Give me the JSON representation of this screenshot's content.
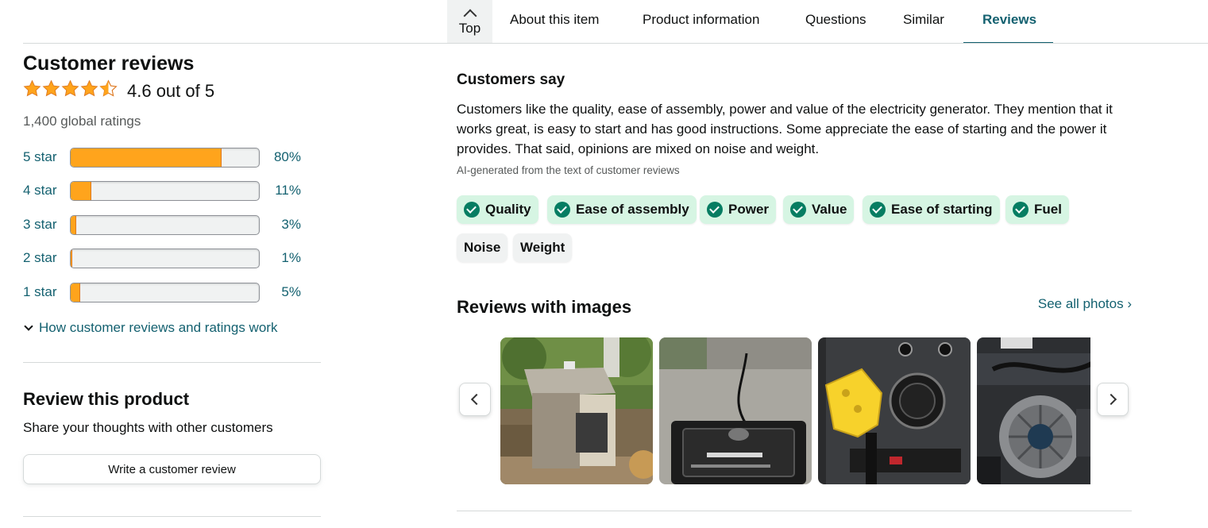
{
  "nav": {
    "top_label": "Top",
    "tabs": [
      {
        "label": "About this item",
        "active": false
      },
      {
        "label": "Product information",
        "active": false
      },
      {
        "label": "Questions",
        "active": false
      },
      {
        "label": "Similar",
        "active": false
      },
      {
        "label": "Reviews",
        "active": true
      }
    ]
  },
  "reviews_summary": {
    "title": "Customer reviews",
    "rating_value": 4.6,
    "rating_text": "4.6 out of 5",
    "global_ratings": "1,400 global ratings",
    "histogram": [
      {
        "label": "5 star",
        "percent_text": "80%",
        "percent": 80
      },
      {
        "label": "4 star",
        "percent_text": "11%",
        "percent": 11
      },
      {
        "label": "3 star",
        "percent_text": "3%",
        "percent": 3
      },
      {
        "label": "2 star",
        "percent_text": "1%",
        "percent": 1
      },
      {
        "label": "1 star",
        "percent_text": "5%",
        "percent": 5
      }
    ],
    "how_link": "How customer reviews and ratings work"
  },
  "review_product": {
    "title": "Review this product",
    "subtitle": "Share your thoughts with other customers",
    "button_label": "Write a customer review"
  },
  "customers_say": {
    "title": "Customers say",
    "summary": "Customers like the quality, ease of assembly, power and value of the electricity generator. They mention that it works great, is easy to start and has good instructions. Some appreciate the ease of starting and the power it provides. That said, opinions are mixed on noise and weight.",
    "ai_note": "AI-generated from the text of customer reviews",
    "aspects": [
      {
        "label": "Quality",
        "sentiment": "positive"
      },
      {
        "label": "Ease of assembly",
        "sentiment": "positive"
      },
      {
        "label": "Power",
        "sentiment": "positive"
      },
      {
        "label": "Value",
        "sentiment": "positive"
      },
      {
        "label": "Ease of starting",
        "sentiment": "positive"
      },
      {
        "label": "Fuel",
        "sentiment": "positive"
      },
      {
        "label": "Noise",
        "sentiment": "mixed"
      },
      {
        "label": "Weight",
        "sentiment": "mixed"
      }
    ]
  },
  "reviews_with_images": {
    "title": "Reviews with images",
    "see_all": "See all photos ›",
    "images": [
      {
        "name": "generator-enclosure-photo"
      },
      {
        "name": "generator-top-view-photo"
      },
      {
        "name": "generator-outlet-plug-photo"
      },
      {
        "name": "generator-recoil-starter-photo"
      }
    ]
  },
  "colors": {
    "link": "#146170",
    "star": "#ffa41c",
    "positive_chip": "#d6f5e3",
    "check": "#067d62"
  }
}
